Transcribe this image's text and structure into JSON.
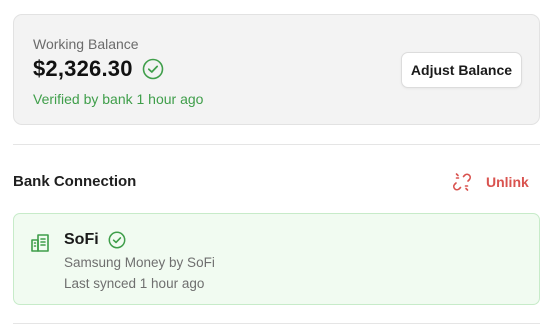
{
  "balance": {
    "label": "Working Balance",
    "amount": "$2,326.30",
    "verified_text": "Verified by bank 1 hour ago",
    "adjust_button_label": "Adjust Balance",
    "verified_icon": "check-circle-icon"
  },
  "bank_connection": {
    "title": "Bank Connection",
    "unlink_label": "Unlink",
    "unlink_icon": "broken-link-icon",
    "bank": {
      "name": "SoFi",
      "icon": "bank-building-icon",
      "verified_icon": "check-circle-icon",
      "subtitle": "Samsung Money by SoFi",
      "sync_status": "Last synced 1 hour ago"
    }
  },
  "colors": {
    "verified_green": "#3f9e4a",
    "unlink_red": "#d9534f",
    "card_gray": "#f3f3f3",
    "bank_card_green": "#f1fbf1"
  }
}
